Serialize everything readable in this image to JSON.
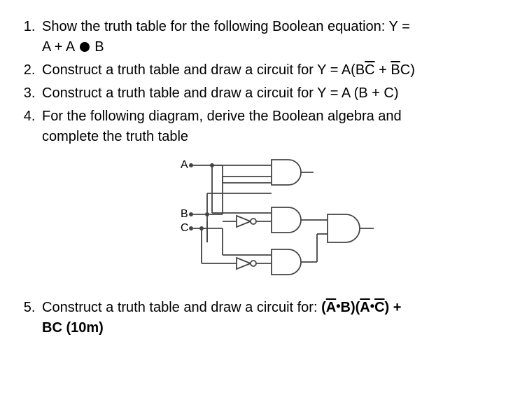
{
  "questions": {
    "q1": {
      "line1": "Show the truth table for the following Boolean equation: Y =",
      "line2_A": "A + A",
      "line2_B": "B"
    },
    "q2": {
      "prefix": "Construct a truth table and draw a circuit for Y = A(B",
      "c_bar": "C",
      "plus": " + ",
      "b_bar": "B",
      "c2": "C)"
    },
    "q3": "Construct a truth table and draw a circuit for Y = A (B  + C)",
    "q4": {
      "line1": "For the following diagram, derive the Boolean algebra and",
      "line2": "complete the truth table"
    },
    "q5": {
      "prefix": "Construct a truth table and draw a circuit for: ",
      "g1_open": "(",
      "g1_a": "A",
      "g1_dot": "•",
      "g1_b": "B)",
      "g2_open": "(",
      "g2_a": "A",
      "g2_dot": "•",
      "g2_c": "C",
      "g2_close": ")",
      "plus": " +",
      "line2": "BC   (10m)"
    }
  },
  "diagram": {
    "labels": {
      "A": "A",
      "B": "B",
      "C": "C"
    },
    "gates": [
      {
        "id": "g1",
        "type": "AND",
        "inputs": [
          "A",
          "B"
        ]
      },
      {
        "id": "n1",
        "type": "NOT",
        "input": "B"
      },
      {
        "id": "n2",
        "type": "NOT",
        "input": "C"
      },
      {
        "id": "g2",
        "type": "AND",
        "inputs": [
          "A",
          "n1"
        ]
      },
      {
        "id": "g3",
        "type": "AND",
        "inputs": [
          "C",
          "n2"
        ]
      },
      {
        "id": "g4",
        "type": "AND",
        "inputs": [
          "g2",
          "g3"
        ],
        "output": true
      }
    ]
  }
}
